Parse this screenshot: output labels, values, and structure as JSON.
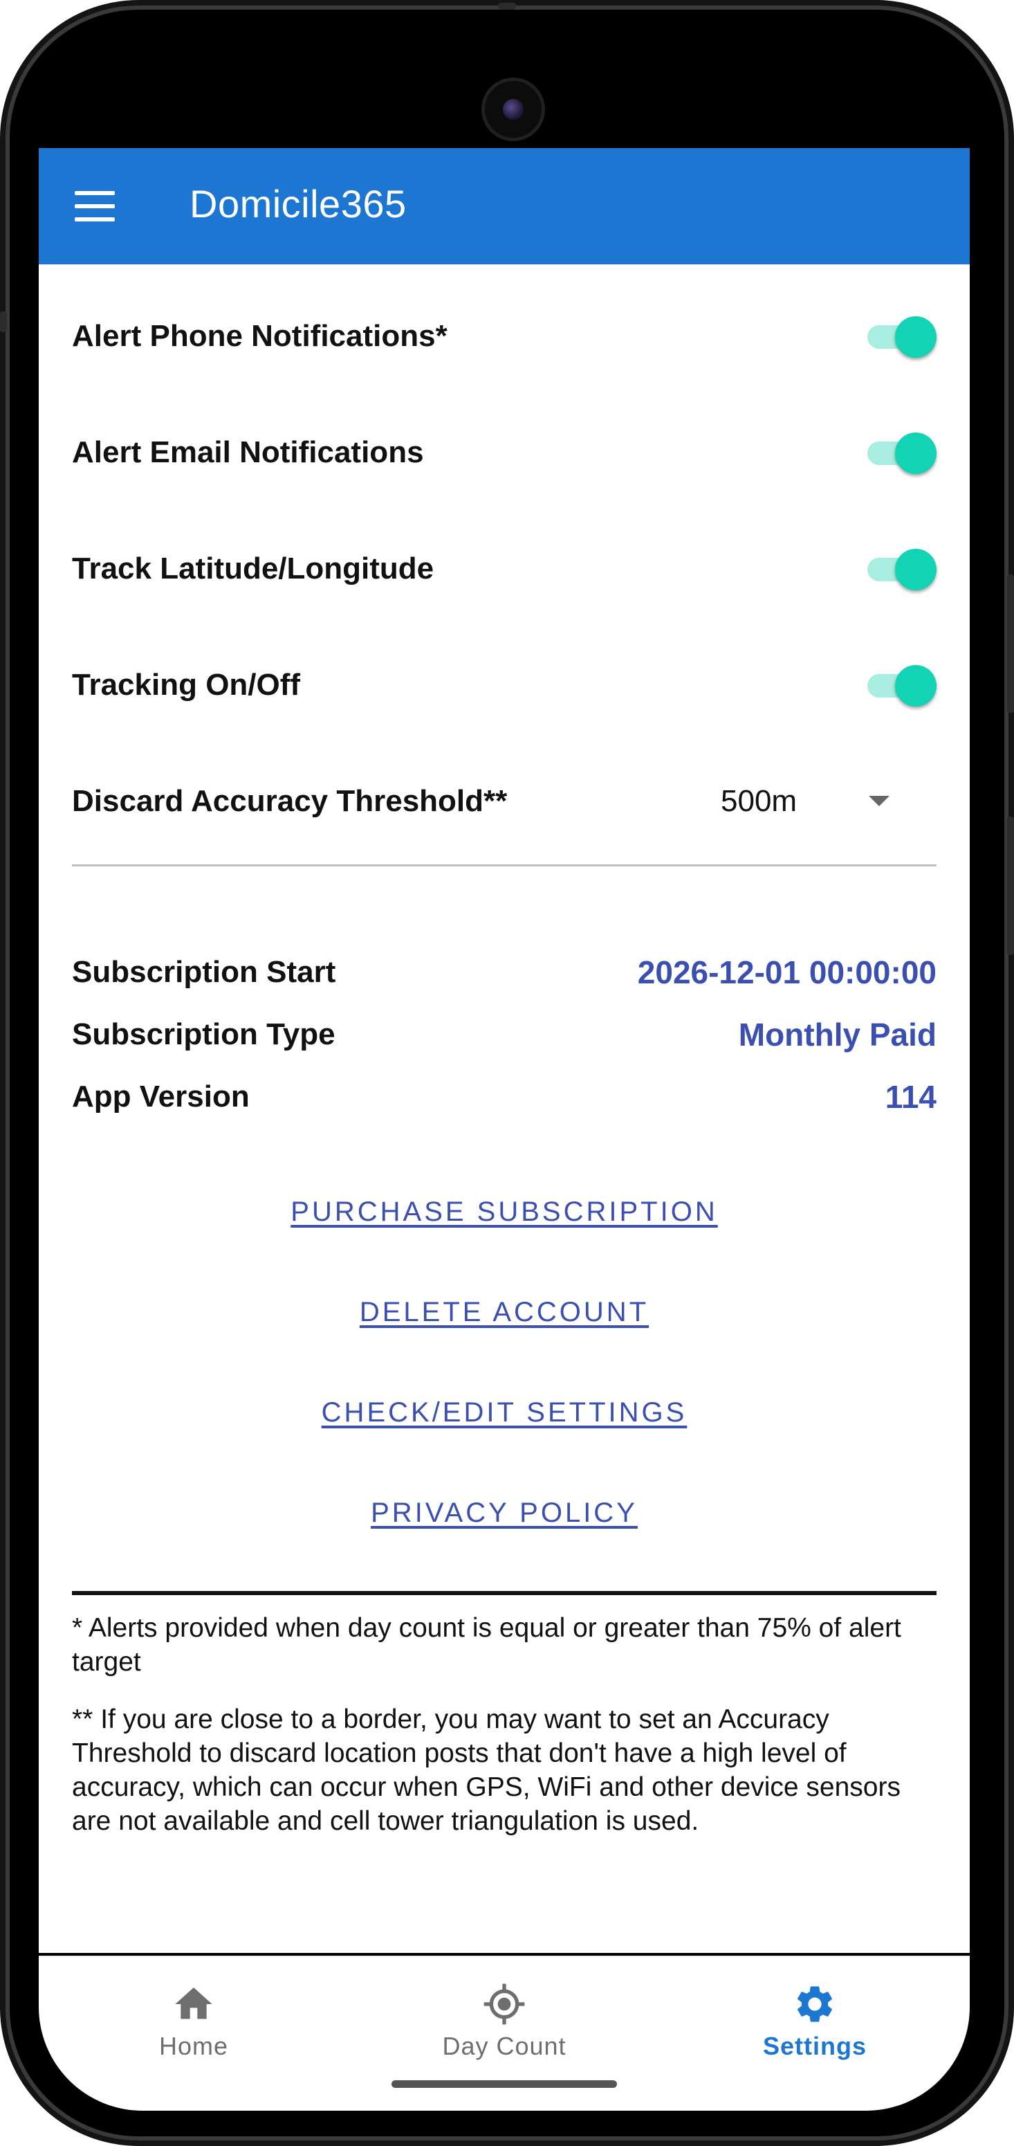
{
  "app": {
    "title": "Domicile365"
  },
  "settings": {
    "toggles": [
      {
        "label": "Alert Phone Notifications*",
        "on": true
      },
      {
        "label": "Alert Email Notifications",
        "on": true
      },
      {
        "label": "Track Latitude/Longitude",
        "on": true
      },
      {
        "label": "Tracking On/Off",
        "on": true
      }
    ],
    "threshold": {
      "label": "Discard Accuracy Threshold**",
      "value": "500m"
    }
  },
  "info": {
    "subscription_start": {
      "label": "Subscription Start",
      "value": "2026-12-01 00:00:00"
    },
    "subscription_type": {
      "label": "Subscription Type",
      "value": "Monthly Paid"
    },
    "app_version": {
      "label": "App Version",
      "value": "114"
    }
  },
  "actions": {
    "purchase": "PURCHASE SUBSCRIPTION",
    "delete": "DELETE ACCOUNT",
    "check_edit": "CHECK/EDIT SETTINGS",
    "privacy": "PRIVACY POLICY"
  },
  "footnotes": {
    "alerts": "* Alerts provided when day count is equal or greater than 75% of alert target",
    "accuracy": "** If you are close to a border, you may want to set an Accuracy Threshold to discard location posts that don't have a high level of accuracy, which can occur when GPS, WiFi and other device sensors are not available and cell tower triangulation is used."
  },
  "nav": {
    "items": [
      {
        "label": "Home",
        "icon": "home-icon",
        "active": false
      },
      {
        "label": "Day Count",
        "icon": "crosshair-icon",
        "active": false
      },
      {
        "label": "Settings",
        "icon": "gear-icon",
        "active": true
      }
    ]
  },
  "colors": {
    "primary": "#1c76d2",
    "link": "#3a4fb0",
    "switch_thumb": "#12d3b4",
    "switch_track": "#a9ede0",
    "nav_inactive": "#6e6e6e"
  }
}
